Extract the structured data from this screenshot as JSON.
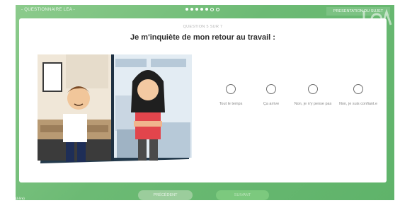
{
  "header": {
    "questionnaire_title": "- QUESTIONNAIRE LEA -",
    "progress": {
      "total": 7,
      "completed": 5
    },
    "presentation_label": "PRESENTATION DU SUJET"
  },
  "question": {
    "number_label": "QUESTION 5 SUR 7",
    "text": "Je m'inquiète de mon retour au travail :"
  },
  "options": [
    {
      "label": "Tout le temps"
    },
    {
      "label": "Ça arrive"
    },
    {
      "label": "Non, je n'y pense pas"
    },
    {
      "label": "Non, je suis confiant.e"
    }
  ],
  "footer": {
    "previous_label": "PRÉCÉDENT",
    "next_label": "SUIVANT",
    "corner_label": "(à lire)"
  },
  "colors": {
    "background_green": "#6cba74",
    "card": "#ffffff",
    "accent": "#7cc97e"
  }
}
